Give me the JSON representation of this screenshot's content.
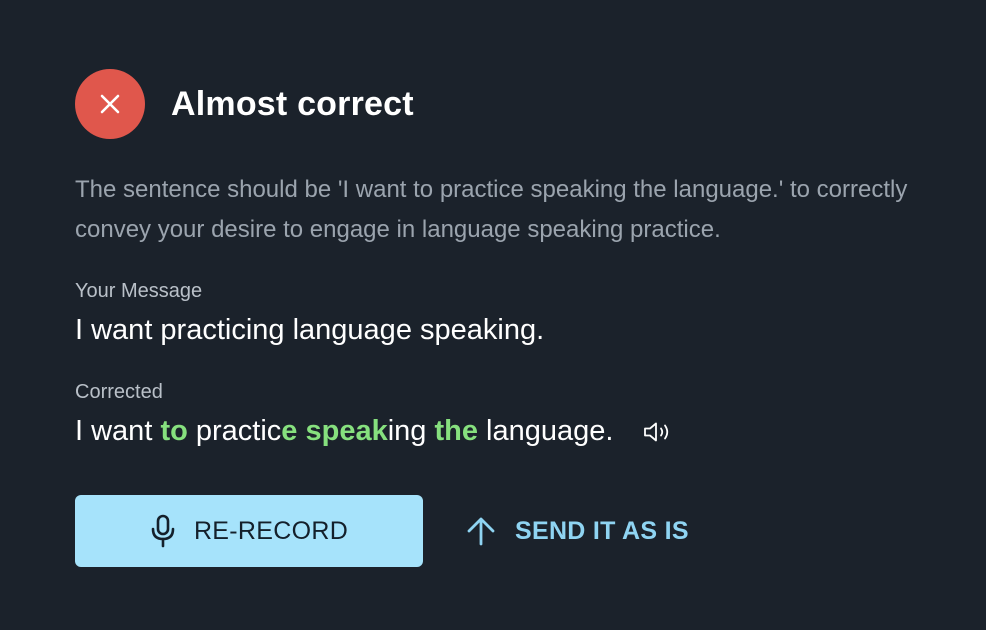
{
  "result": {
    "title": "Almost correct",
    "status_color": "#e0574c",
    "icon": "close-icon"
  },
  "explanation": "The sentence should be 'I want to practice speaking the language.' to correctly convey your desire to engage in language speaking practice.",
  "your_message": {
    "label": "Your Message",
    "text": "I want practicing language speaking."
  },
  "corrected": {
    "label": "Corrected",
    "segments": [
      {
        "text": "I want ",
        "highlight": false
      },
      {
        "text": "to",
        "highlight": true
      },
      {
        "text": " practic",
        "highlight": false
      },
      {
        "text": "e speak",
        "highlight": true
      },
      {
        "text": "ing ",
        "highlight": false
      },
      {
        "text": "the",
        "highlight": true
      },
      {
        "text": " language.",
        "highlight": false
      }
    ],
    "highlight_color": "#86e07e",
    "audio_icon": "speaker-icon"
  },
  "actions": {
    "rerecord_label": "RE-RECORD",
    "rerecord_icon": "microphone-icon",
    "send_label": "SEND IT AS IS",
    "send_icon": "arrow-up-icon"
  },
  "colors": {
    "background": "#1b222b",
    "primary_button": "#a6e3fb",
    "secondary_text": "#8fd4f2"
  }
}
